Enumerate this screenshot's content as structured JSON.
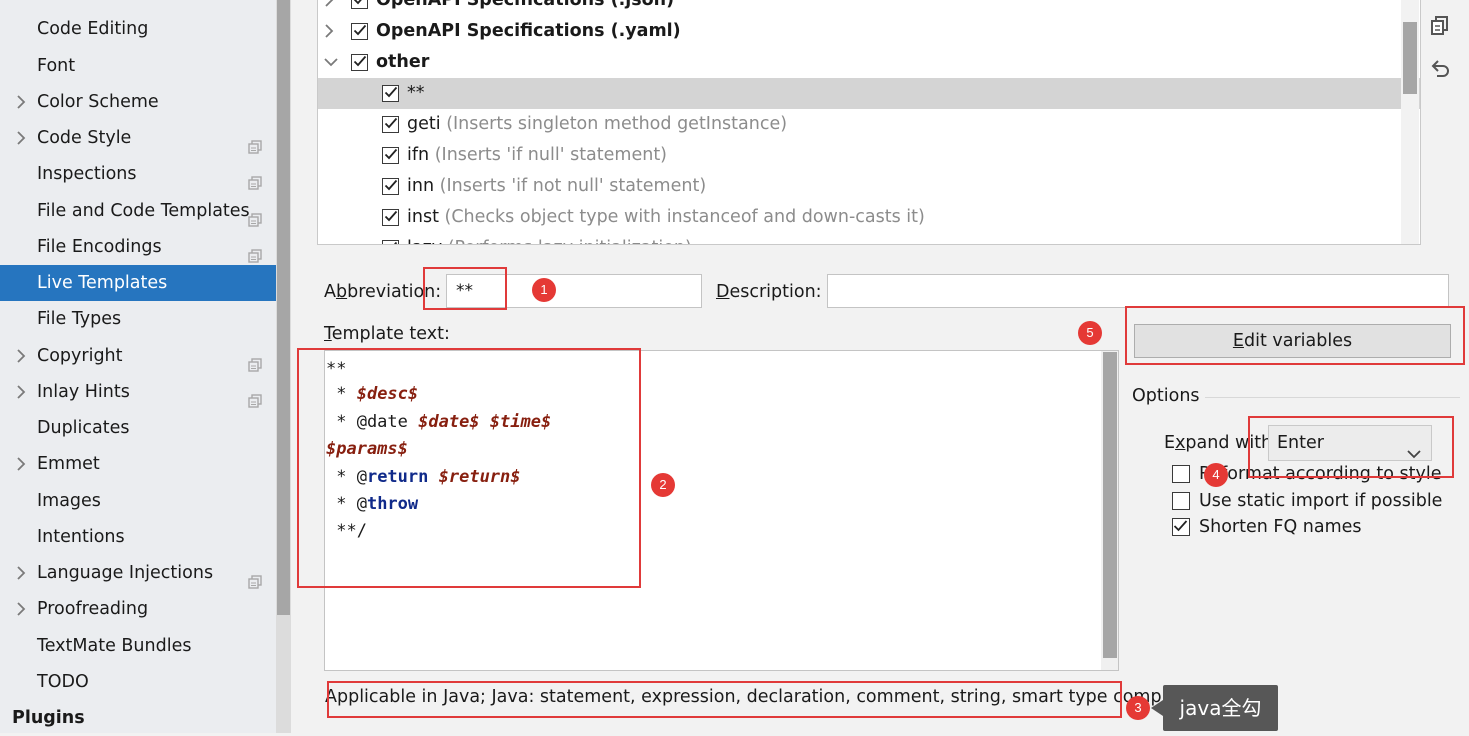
{
  "sidebar": {
    "items": [
      {
        "label": "Code Editing",
        "expandable": false,
        "copy_icon": false,
        "selected": false,
        "bold": false
      },
      {
        "label": "Font",
        "expandable": false,
        "copy_icon": false,
        "selected": false,
        "bold": false
      },
      {
        "label": "Color Scheme",
        "expandable": true,
        "copy_icon": false,
        "selected": false,
        "bold": false
      },
      {
        "label": "Code Style",
        "expandable": true,
        "copy_icon": true,
        "selected": false,
        "bold": false
      },
      {
        "label": "Inspections",
        "expandable": false,
        "copy_icon": true,
        "selected": false,
        "bold": false
      },
      {
        "label": "File and Code Templates",
        "expandable": false,
        "copy_icon": true,
        "selected": false,
        "bold": false
      },
      {
        "label": "File Encodings",
        "expandable": false,
        "copy_icon": true,
        "selected": false,
        "bold": false
      },
      {
        "label": "Live Templates",
        "expandable": false,
        "copy_icon": false,
        "selected": true,
        "bold": false
      },
      {
        "label": "File Types",
        "expandable": false,
        "copy_icon": false,
        "selected": false,
        "bold": false
      },
      {
        "label": "Copyright",
        "expandable": true,
        "copy_icon": true,
        "selected": false,
        "bold": false
      },
      {
        "label": "Inlay Hints",
        "expandable": true,
        "copy_icon": true,
        "selected": false,
        "bold": false
      },
      {
        "label": "Duplicates",
        "expandable": false,
        "copy_icon": false,
        "selected": false,
        "bold": false
      },
      {
        "label": "Emmet",
        "expandable": true,
        "copy_icon": false,
        "selected": false,
        "bold": false
      },
      {
        "label": "Images",
        "expandable": false,
        "copy_icon": false,
        "selected": false,
        "bold": false
      },
      {
        "label": "Intentions",
        "expandable": false,
        "copy_icon": false,
        "selected": false,
        "bold": false
      },
      {
        "label": "Language Injections",
        "expandable": true,
        "copy_icon": true,
        "selected": false,
        "bold": false
      },
      {
        "label": "Proofreading",
        "expandable": true,
        "copy_icon": false,
        "selected": false,
        "bold": false
      },
      {
        "label": "TextMate Bundles",
        "expandable": false,
        "copy_icon": false,
        "selected": false,
        "bold": false
      },
      {
        "label": "TODO",
        "expandable": false,
        "copy_icon": false,
        "selected": false,
        "bold": false
      },
      {
        "label": "Plugins",
        "expandable": false,
        "copy_icon": false,
        "selected": false,
        "bold": true
      }
    ]
  },
  "tree": {
    "groups": [
      {
        "label": "OpenAPI Specifications (.json)",
        "expanded": false,
        "checked": true
      },
      {
        "label": "OpenAPI Specifications (.yaml)",
        "expanded": false,
        "checked": true
      },
      {
        "label": "other",
        "expanded": true,
        "checked": true
      }
    ],
    "items": [
      {
        "abbr": "**",
        "desc": "",
        "checked": true,
        "selected": true
      },
      {
        "abbr": "geti",
        "desc": "(Inserts singleton method getInstance)",
        "checked": true,
        "selected": false
      },
      {
        "abbr": "ifn",
        "desc": "(Inserts 'if null' statement)",
        "checked": true,
        "selected": false
      },
      {
        "abbr": "inn",
        "desc": "(Inserts 'if not null' statement)",
        "checked": true,
        "selected": false
      },
      {
        "abbr": "inst",
        "desc": "(Checks object type with instanceof and down-casts it)",
        "checked": true,
        "selected": false
      },
      {
        "abbr": "lazy",
        "desc": "(Performs lazy initialization)",
        "checked": true,
        "selected": false
      }
    ],
    "tool_icons": [
      "copy-icon",
      "undo-icon"
    ]
  },
  "form": {
    "abbreviation_label_pre": "A",
    "abbreviation_label_mn": "b",
    "abbreviation_label_post": "breviation:",
    "abbreviation_value": "**",
    "description_label_mn": "D",
    "description_label_post": "escription:",
    "description_value": "",
    "template_text_label_mn": "T",
    "template_text_label_post": "emplate text:",
    "template_lines": [
      [
        {
          "t": "**",
          "c": "plain"
        }
      ],
      [
        {
          "t": " * ",
          "c": "plain"
        },
        {
          "t": "$desc$",
          "c": "var"
        }
      ],
      [
        {
          "t": " * @date ",
          "c": "plain"
        },
        {
          "t": "$date$",
          "c": "var"
        },
        {
          "t": " ",
          "c": "plain"
        },
        {
          "t": "$time$",
          "c": "var"
        }
      ],
      [
        {
          "t": "$params$",
          "c": "var"
        }
      ],
      [
        {
          "t": " * @",
          "c": "plain"
        },
        {
          "t": "return",
          "c": "kw"
        },
        {
          "t": " ",
          "c": "plain"
        },
        {
          "t": "$return$",
          "c": "var"
        }
      ],
      [
        {
          "t": " * @",
          "c": "plain"
        },
        {
          "t": "throw",
          "c": "kw"
        }
      ],
      [
        {
          "t": " **/",
          "c": "plain"
        }
      ]
    ],
    "applicable_text": "Applicable in Java; Java: statement, expression, declaration, comment, string, smart type complet...",
    "edit_variables_mn": "E",
    "edit_variables_post": "dit variables"
  },
  "options": {
    "title": "Options",
    "expand_with_pre": "E",
    "expand_with_mn": "x",
    "expand_with_post": "pand with",
    "expand_with_value": "Enter",
    "checkboxes": [
      {
        "label": "Reformat according to style",
        "checked": false
      },
      {
        "label": "Use static import if possible",
        "checked": false
      },
      {
        "label": "Shorten FQ names",
        "checked": true
      }
    ]
  },
  "annotations": {
    "badges": [
      "1",
      "2",
      "3",
      "4",
      "5"
    ],
    "tooltip": "java全勾",
    "color": "#e03a3a"
  }
}
